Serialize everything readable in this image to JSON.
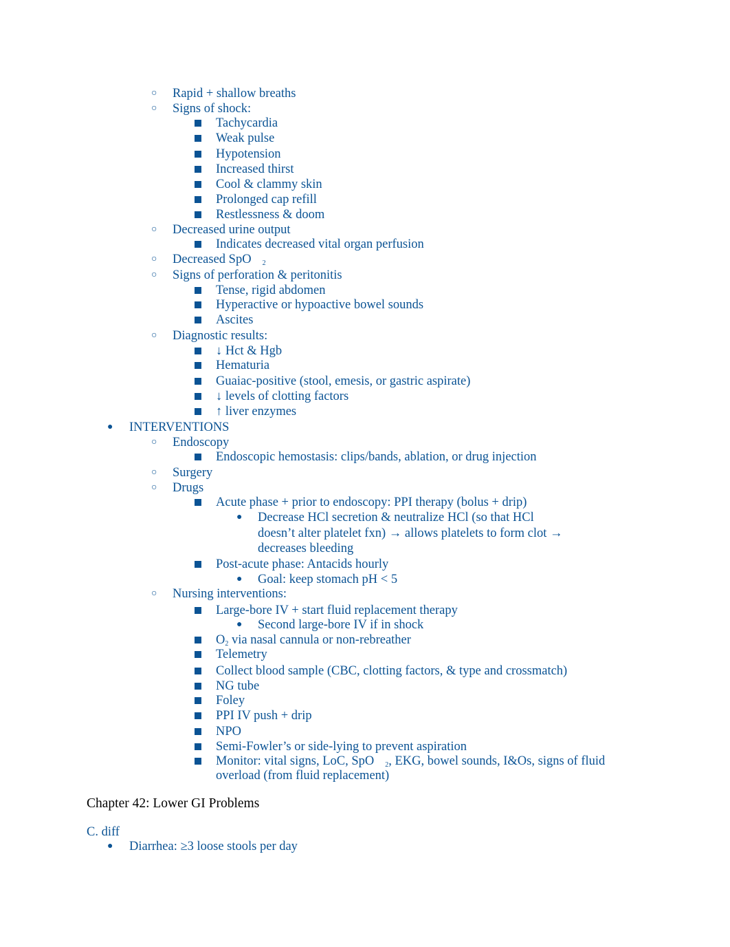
{
  "document": {
    "text_color": "#0b5394",
    "heading_color": "#000000",
    "lines": [
      {
        "level": 2,
        "text": "Rapid + shallow breaths"
      },
      {
        "level": 2,
        "text": "Signs of shock:"
      },
      {
        "level": 3,
        "text": "Tachycardia"
      },
      {
        "level": 3,
        "text": "Weak pulse"
      },
      {
        "level": 3,
        "text": "Hypotension"
      },
      {
        "level": 3,
        "text": "Increased thirst"
      },
      {
        "level": 3,
        "text": "Cool & clammy skin"
      },
      {
        "level": 3,
        "text": "Prolonged cap refill"
      },
      {
        "level": 3,
        "text": "Restlessness & doom"
      },
      {
        "level": 2,
        "text": "Decreased urine output"
      },
      {
        "level": 3,
        "text": "Indicates decreased vital organ perfusion"
      },
      {
        "level": 2,
        "text": "Decreased SpO",
        "sub": "2"
      },
      {
        "level": 2,
        "text": "Signs of perforation & peritonitis"
      },
      {
        "level": 3,
        "text": "Tense, rigid abdomen"
      },
      {
        "level": 3,
        "text": "Hyperactive or hypoactive bowel sounds"
      },
      {
        "level": 3,
        "text": "Ascites"
      },
      {
        "level": 2,
        "text": "Diagnostic results:"
      },
      {
        "level": 3,
        "text": "↓ Hct & Hgb"
      },
      {
        "level": 3,
        "text": "Hematuria"
      },
      {
        "level": 3,
        "text": "Guaiac-positive (stool, emesis, or gastric aspirate)"
      },
      {
        "level": 3,
        "text": "↓ levels of clotting factors"
      },
      {
        "level": 3,
        "text": "↑ liver enzymes"
      },
      {
        "level": 1,
        "text": "INTERVENTIONS"
      },
      {
        "level": 2,
        "text": "Endoscopy"
      },
      {
        "level": 3,
        "text": "Endoscopic hemostasis: clips/bands, ablation, or drug injection"
      },
      {
        "level": 2,
        "text": "Surgery"
      },
      {
        "level": 2,
        "text": "Drugs"
      },
      {
        "level": 3,
        "text": "Acute phase + prior to endoscopy: PPI therapy (bolus + drip)"
      },
      {
        "level": 4,
        "text": "Decrease HCl secretion & neutralize HCl (so that HCl"
      },
      {
        "level": 5,
        "text": "doesn’t alter platelet fxn) → allows platelets to form clot →"
      },
      {
        "level": 5,
        "text": "decreases bleeding"
      },
      {
        "level": 3,
        "text": "Post-acute phase: Antacids hourly"
      },
      {
        "level": 4,
        "text": "Goal: keep stomach pH < 5"
      },
      {
        "level": 2,
        "text": "Nursing interventions:"
      },
      {
        "level": 3,
        "text": "Large-bore IV + start fluid replacement therapy"
      },
      {
        "level": 4,
        "text": "Second large-bore IV if in shock"
      },
      {
        "level": 3,
        "text": "O",
        "sub_inline": "2",
        "after": " via nasal cannula or non-rebreather"
      },
      {
        "level": 3,
        "text": "Telemetry"
      },
      {
        "level": 3,
        "text": "Collect blood sample (CBC, clotting factors, & type and crossmatch)"
      },
      {
        "level": 3,
        "text": "NG tube"
      },
      {
        "level": 3,
        "text": "Foley"
      },
      {
        "level": 3,
        "text": "PPI IV push + drip"
      },
      {
        "level": 3,
        "text": "NPO"
      },
      {
        "level": 3,
        "text": "Semi-Fowler’s or side-lying to prevent aspiration"
      },
      {
        "level": 3,
        "text": "Monitor: vital signs, LoC, SpO",
        "sub": "2",
        "after": ", EKG, bowel sounds, I&Os, signs of fluid"
      },
      {
        "level": 6,
        "text": "overload (from fluid replacement)"
      },
      {
        "level": 0,
        "text": "Chapter 42: Lower GI Problems",
        "heading": true
      },
      {
        "level": 0,
        "text": "C. diff"
      },
      {
        "level": 1,
        "text": "Diarrhea: ≥3 loose stools per day"
      }
    ],
    "y_positions": []
  }
}
